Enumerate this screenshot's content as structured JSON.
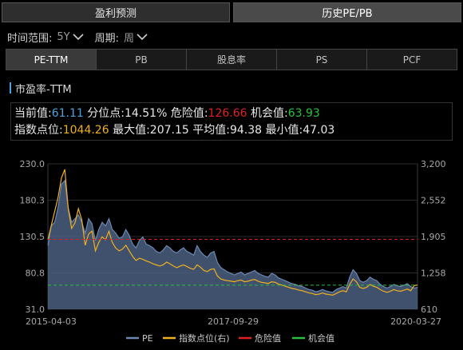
{
  "top_tabs": [
    {
      "label": "盈利预测",
      "active": false
    },
    {
      "label": "历史PE/PB",
      "active": true
    }
  ],
  "filters": {
    "range_label": "时间范围:",
    "range_value": "5Y",
    "period_label": "周期:",
    "period_value": "周"
  },
  "sub_tabs": [
    {
      "label": "PE-TTM",
      "active": true
    },
    {
      "label": "PB",
      "active": false
    },
    {
      "label": "股息率",
      "active": false
    },
    {
      "label": "PS",
      "active": false
    },
    {
      "label": "PCF",
      "active": false
    }
  ],
  "section_title": "市盈率-TTM",
  "stats": {
    "current_label": "当前值:",
    "current_value": "61.11",
    "percentile_label": "分位点:",
    "percentile_value": "14.51%",
    "danger_label": "危险值:",
    "danger_value": "126.66",
    "opportunity_label": "机会值:",
    "opportunity_value": "63.93",
    "index_label": "指数点位:",
    "index_value": "1044.26",
    "max_label": "最大值:",
    "max_value": "207.15",
    "avg_label": "平均值:",
    "avg_value": "94.38",
    "min_label": "最小值:",
    "min_value": "47.03"
  },
  "colors": {
    "pe_line": "#6b88b3",
    "pe_fill": "#4a5f80",
    "index_line": "#f0b020",
    "danger": "#e02020",
    "opportunity": "#28c040",
    "current_value": "#4aa3df",
    "index_value": "#f0b020",
    "axis_text": "#a8a8a8"
  },
  "chart_data": {
    "type": "area",
    "x_start_label": "2015-04-03",
    "x_mid_label": "2017-09-29",
    "x_end_label": "2020-03-27",
    "y_left_ticks": [
      "230.0",
      "180.3",
      "130.5",
      "80.8",
      "31.0"
    ],
    "y_right_ticks": [
      "3,200",
      "2,552",
      "1,905",
      "1,258",
      "610"
    ],
    "ylim_left": [
      31.0,
      230.0
    ],
    "ylim_right": [
      610,
      3200
    ],
    "danger_line": 126.66,
    "opportunity_line": 63.93,
    "legend": [
      {
        "name": "PE",
        "kind": "pe"
      },
      {
        "name": "指数点位(右)",
        "kind": "index"
      },
      {
        "name": "危险值",
        "kind": "danger"
      },
      {
        "name": "机会值",
        "kind": "opportunity"
      }
    ],
    "pe_series": [
      118,
      145,
      150,
      170,
      202,
      207,
      170,
      150,
      155,
      160,
      150,
      135,
      155,
      148,
      125,
      140,
      150,
      145,
      155,
      140,
      135,
      128,
      130,
      140,
      132,
      120,
      115,
      125,
      130,
      120,
      118,
      115,
      110,
      108,
      112,
      118,
      115,
      110,
      108,
      112,
      115,
      110,
      108,
      105,
      118,
      110,
      105,
      102,
      108,
      110,
      95,
      88,
      85,
      82,
      80,
      78,
      80,
      82,
      78,
      80,
      82,
      84,
      80,
      78,
      76,
      75,
      80,
      78,
      74,
      72,
      70,
      68,
      66,
      65,
      63,
      62,
      60,
      58,
      57,
      55,
      56,
      58,
      56,
      55,
      54,
      58,
      60,
      62,
      60,
      75,
      85,
      80,
      70,
      68,
      70,
      75,
      72,
      70,
      65,
      62,
      60,
      62,
      65,
      63,
      62,
      64,
      66,
      62,
      60,
      61
    ],
    "index_series": [
      1850,
      2100,
      2350,
      2600,
      2950,
      3100,
      2400,
      2050,
      2150,
      2400,
      2200,
      1750,
      1950,
      2000,
      1650,
      1800,
      1900,
      1850,
      2000,
      1800,
      1700,
      1650,
      1680,
      1750,
      1650,
      1550,
      1480,
      1520,
      1500,
      1470,
      1450,
      1420,
      1400,
      1380,
      1400,
      1450,
      1420,
      1380,
      1350,
      1380,
      1400,
      1370,
      1340,
      1320,
      1400,
      1360,
      1300,
      1280,
      1320,
      1330,
      1200,
      1150,
      1130,
      1120,
      1110,
      1100,
      1120,
      1130,
      1100,
      1110,
      1130,
      1140,
      1110,
      1090,
      1080,
      1070,
      1100,
      1090,
      1060,
      1040,
      1020,
      1000,
      980,
      970,
      950,
      940,
      920,
      900,
      890,
      870,
      880,
      900,
      880,
      870,
      860,
      890,
      920,
      940,
      920,
      1050,
      1150,
      1100,
      1000,
      980,
      1000,
      1050,
      1020,
      1000,
      960,
      930,
      910,
      930,
      960,
      940,
      930,
      950,
      970,
      940,
      1030,
      1044
    ]
  }
}
